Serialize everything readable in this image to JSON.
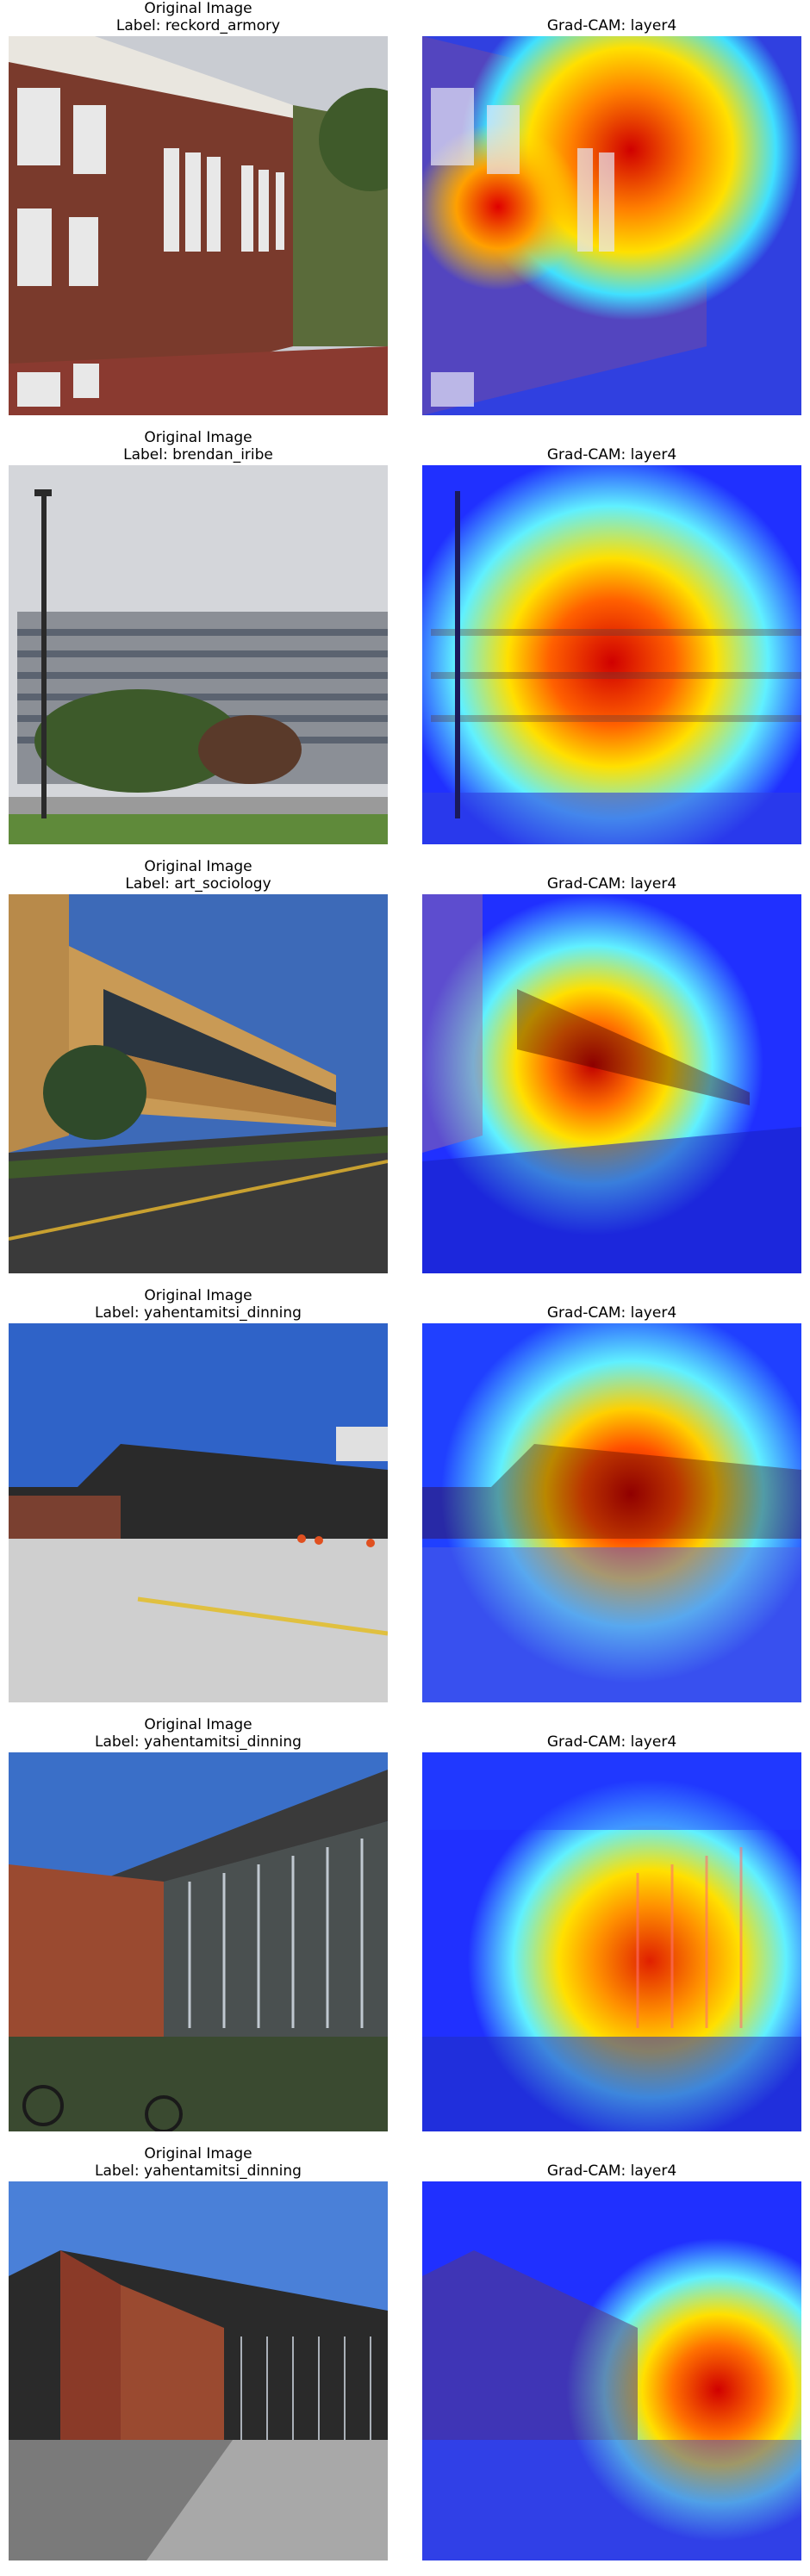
{
  "rows": [
    {
      "left_title_1": "Original Image",
      "left_title_2": "Label: reckord_armory",
      "right_title": "Grad-CAM: layer4"
    },
    {
      "left_title_1": "Original Image",
      "left_title_2": "Label: brendan_iribe",
      "right_title": "Grad-CAM: layer4"
    },
    {
      "left_title_1": "Original Image",
      "left_title_2": "Label: art_sociology",
      "right_title": "Grad-CAM: layer4"
    },
    {
      "left_title_1": "Original Image",
      "left_title_2": "Label: yahentamitsi_dinning",
      "right_title": "Grad-CAM: layer4"
    },
    {
      "left_title_1": "Original Image",
      "left_title_2": "Label: yahentamitsi_dinning",
      "right_title": "Grad-CAM: layer4"
    },
    {
      "left_title_1": "Original Image",
      "left_title_2": "Label: yahentamitsi_dinning",
      "right_title": "Grad-CAM: layer4"
    }
  ],
  "colors": {
    "heat_hot": "#d00000",
    "heat_warm": "#ffd000",
    "heat_mid": "#40e0ff",
    "heat_cool": "#2030ff"
  }
}
